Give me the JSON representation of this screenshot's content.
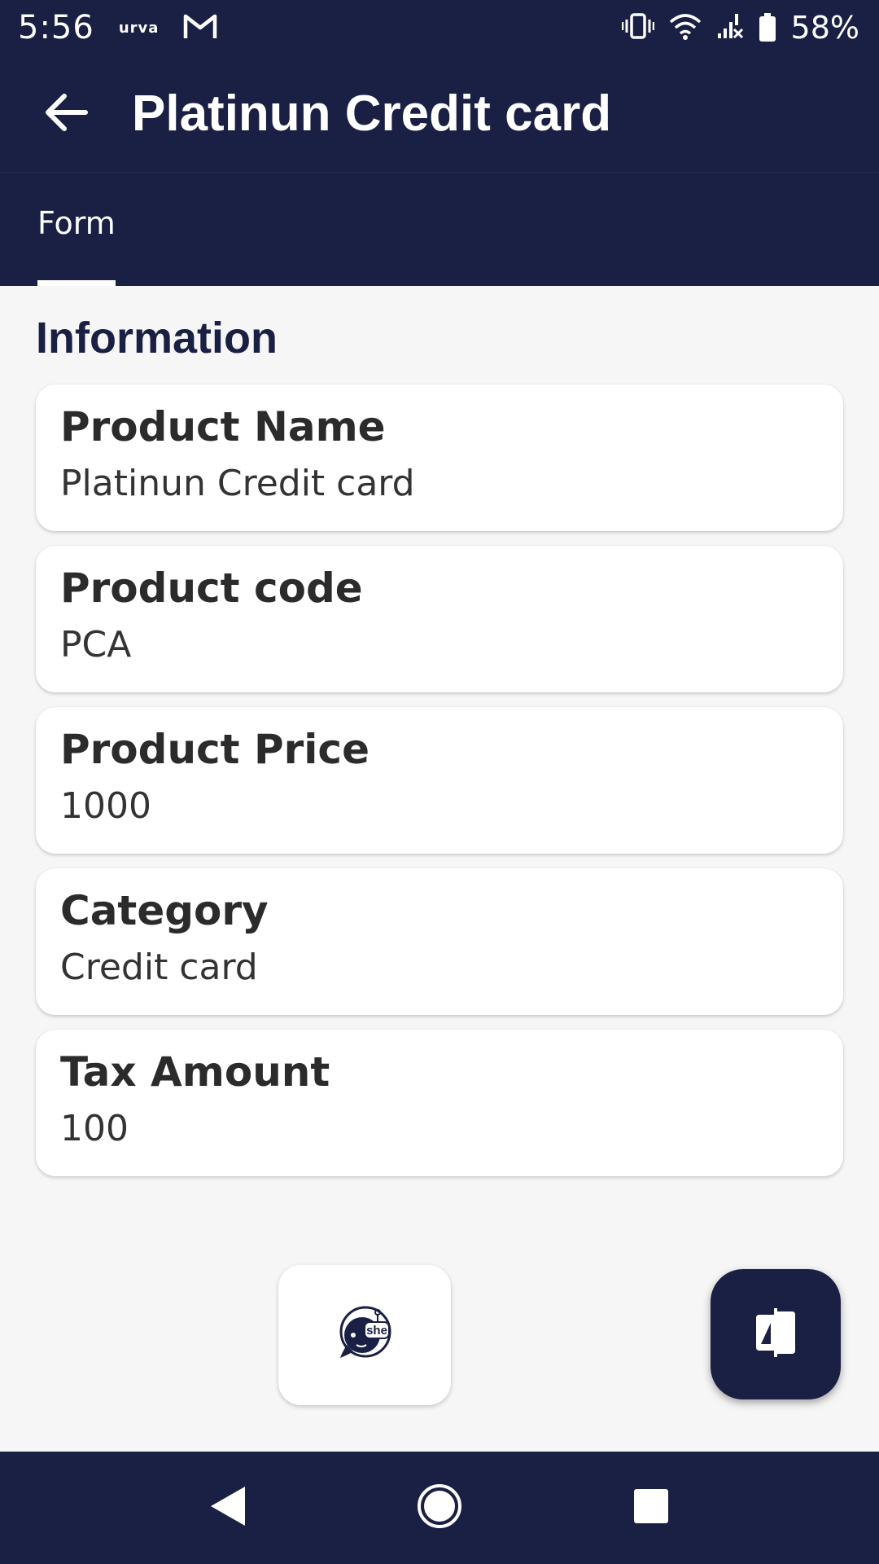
{
  "status_bar": {
    "time": "5:56",
    "brand": "urva",
    "battery": "58%"
  },
  "app_bar": {
    "title": "Platinun Credit card"
  },
  "tabs": [
    {
      "label": "Form",
      "selected": true
    }
  ],
  "section": {
    "title": "Information"
  },
  "fields": [
    {
      "label": "Product Name",
      "value": "Platinun Credit card"
    },
    {
      "label": "Product code",
      "value": "PCA"
    },
    {
      "label": "Product Price",
      "value": "1000"
    },
    {
      "label": "Category",
      "value": "Credit card"
    },
    {
      "label": "Tax Amount",
      "value": "100"
    }
  ],
  "chat_logo": {
    "text": "she",
    "icon": "she-chat-logo"
  },
  "fab": {
    "icon": "compare-icon"
  },
  "colors": {
    "primary": "#1a1f44",
    "background": "#f6f6f6",
    "card": "#ffffff"
  }
}
